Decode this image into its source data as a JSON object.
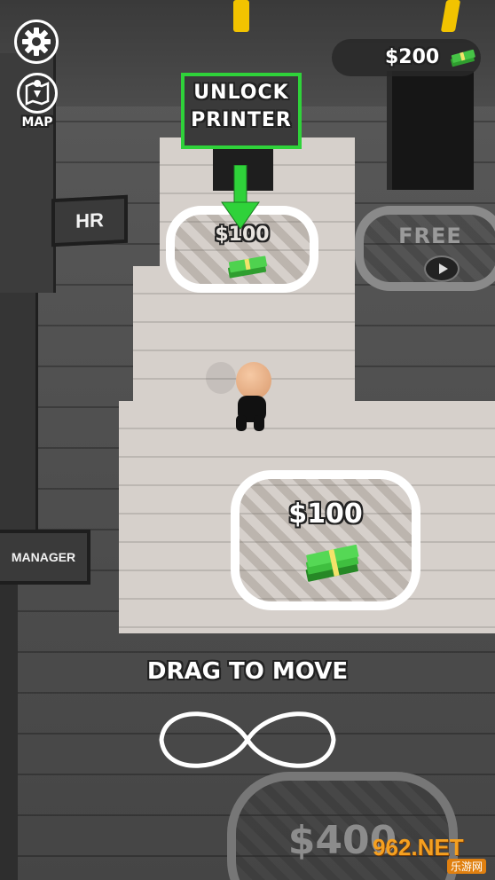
{
  "hud": {
    "settings_icon": "gear-icon",
    "map_icon": "map-icon",
    "map_label": "MAP",
    "money": "$200",
    "money_icon": "cash-stack-icon"
  },
  "tooltip": {
    "line1": "UNLOCK",
    "line2": "PRINTER",
    "arrow_icon": "arrow-down-icon",
    "border_color": "#2fd23a"
  },
  "pads": {
    "printer_price": "$100",
    "free_label": "FREE",
    "free_icon": "play-icon",
    "main_price": "$100",
    "bottom_price": "$400"
  },
  "signs": {
    "hr": "HR",
    "manager": "MANAGER"
  },
  "tutorial": {
    "drag_label": "DRAG TO MOVE",
    "infinity_icon": "infinity-gesture-icon"
  },
  "watermark": {
    "site": "962.NET",
    "subtitle": "乐游网"
  },
  "colors": {
    "cash_green": "#3fbf3f",
    "arrow_green": "#2fd23a"
  }
}
